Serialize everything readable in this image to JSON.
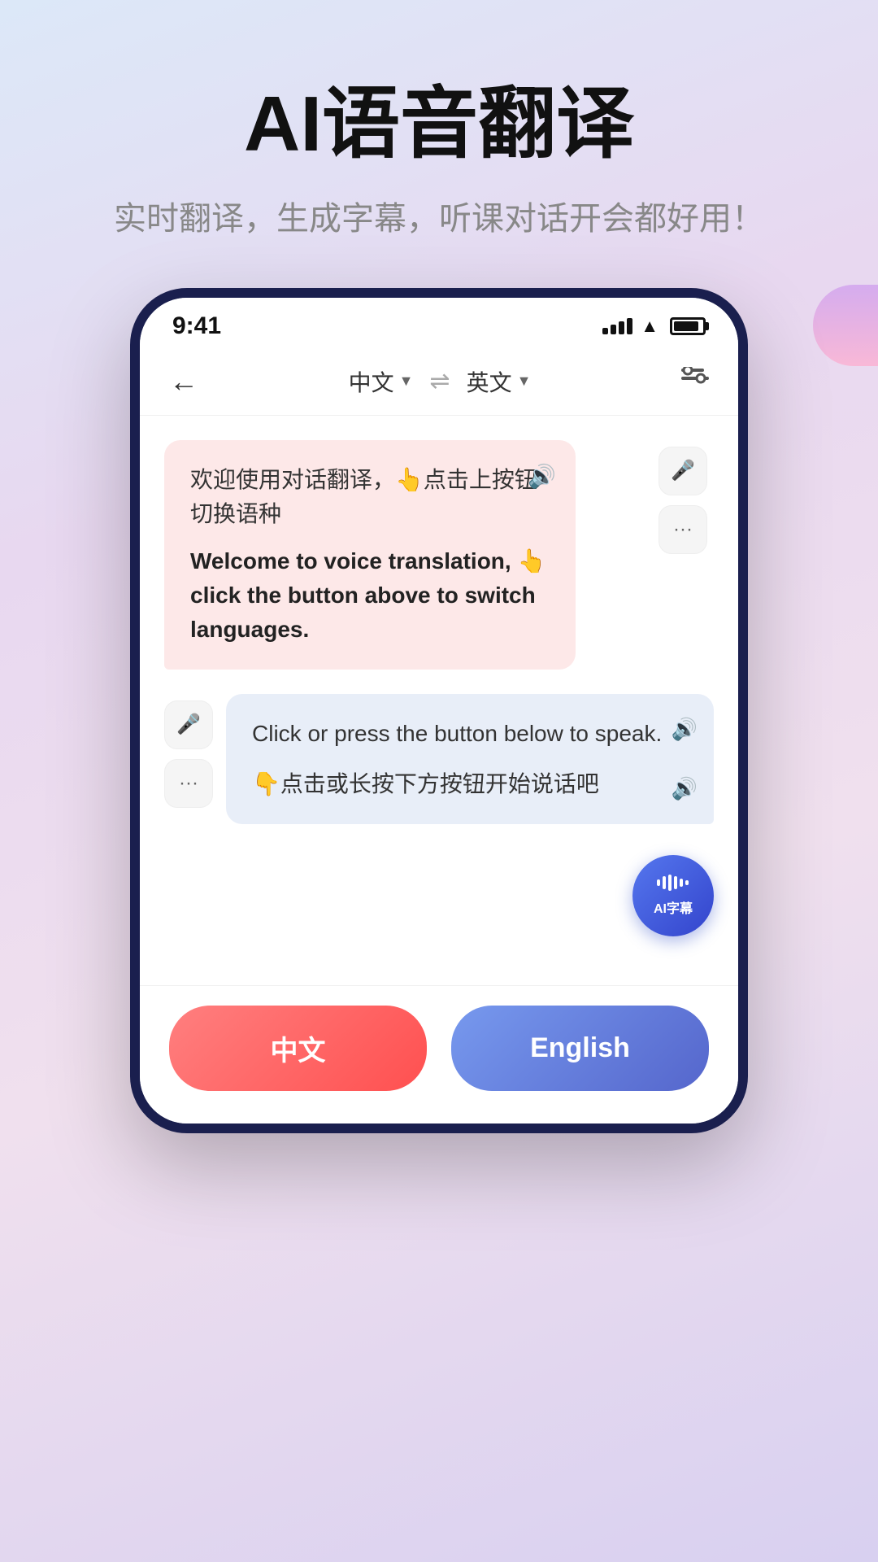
{
  "hero": {
    "title": "AI语音翻译",
    "subtitle": "实时翻译，生成字幕，听课对话开会都好用！"
  },
  "status_bar": {
    "time": "9:41"
  },
  "app_header": {
    "back_label": "←",
    "lang_left": "中文",
    "lang_right": "英文",
    "swap_label": "⇌"
  },
  "bubble_left": {
    "cn_text": "欢迎使用对话翻译，👆点击上按钮切换语种",
    "en_text": "Welcome to voice translation, 👆 click the button above to switch languages."
  },
  "bubble_right": {
    "en_text": "Click or press the button below to speak.",
    "cn_text": "👇点击或长按下方按钮开始说话吧"
  },
  "ai_caption_btn": {
    "label": "AI字幕"
  },
  "bottom_buttons": {
    "chinese_label": "中文",
    "english_label": "English"
  }
}
